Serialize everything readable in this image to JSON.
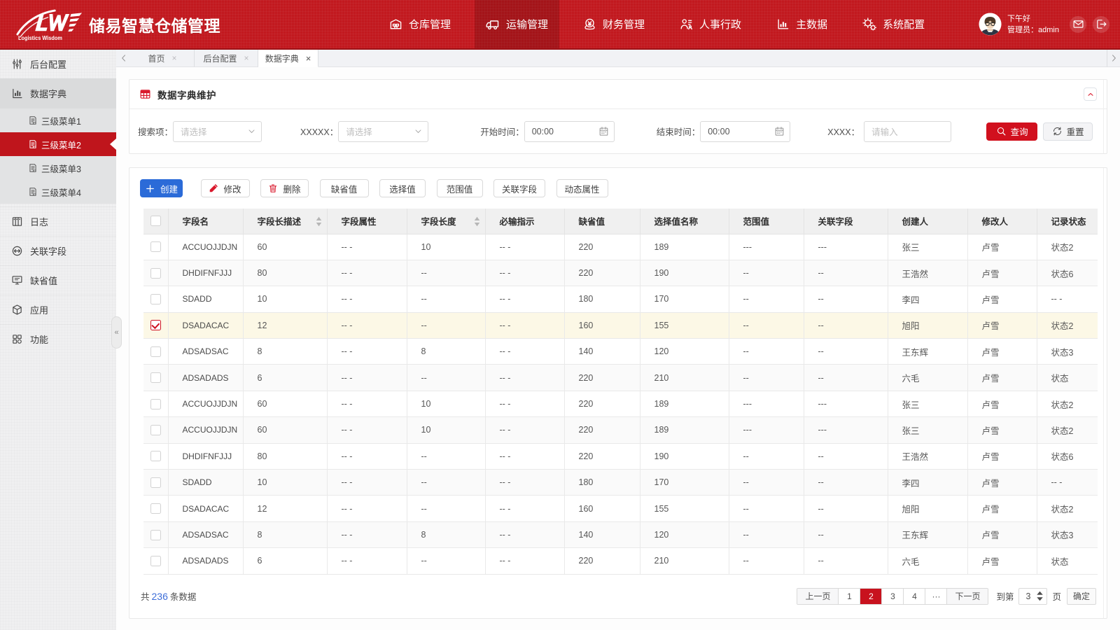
{
  "app": {
    "logo_mark": "LW",
    "logo_sub": "Logistics Wisdom",
    "title": "储易智慧仓储管理"
  },
  "topnav": {
    "items": [
      {
        "label": "仓库管理",
        "icon": "warehouse-icon",
        "active": false
      },
      {
        "label": "运输管理",
        "icon": "truck-icon",
        "active": true
      },
      {
        "label": "财务管理",
        "icon": "finance-icon",
        "active": false
      },
      {
        "label": "人事行政",
        "icon": "hr-icon",
        "active": false
      },
      {
        "label": "主数据",
        "icon": "masterdata-icon",
        "active": false
      },
      {
        "label": "系统配置",
        "icon": "gear-icon",
        "active": false
      }
    ]
  },
  "user": {
    "greeting": "下午好",
    "role": "管理员：admin"
  },
  "tabbar": {
    "tabs": [
      {
        "label": "首页",
        "active": false
      },
      {
        "label": "后台配置",
        "active": false
      },
      {
        "label": "数据字典",
        "active": true
      }
    ],
    "close_glyph": "×"
  },
  "sidebar": {
    "collapse_glyph": "«",
    "items": [
      {
        "label": "后台配置"
      },
      {
        "label": "数据字典",
        "open": true
      },
      {
        "label": "日志"
      },
      {
        "label": "关联字段"
      },
      {
        "label": "缺省值"
      },
      {
        "label": "应用"
      },
      {
        "label": "功能"
      }
    ],
    "submenu": [
      {
        "label": "三级菜单1",
        "active": false
      },
      {
        "label": "三级菜单2",
        "active": true
      },
      {
        "label": "三级菜单3",
        "active": false
      },
      {
        "label": "三级菜单4",
        "active": false
      }
    ]
  },
  "panel": {
    "title": "数据字典维护"
  },
  "filters": {
    "search_label": "搜索项：",
    "search_placeholder": "请选择",
    "xxxxx_label": "XXXXX：",
    "xxxxx_placeholder": "请选择",
    "start_label": "开始时间：",
    "start_value": "00:00",
    "end_label": "结束时间：",
    "end_value": "00:00",
    "xxxx_label": "XXXX：",
    "xxxx_placeholder": "请输入",
    "query_label": "查询",
    "reset_label": "重置"
  },
  "toolbar": {
    "buttons": [
      {
        "label": "创建",
        "kind": "primary",
        "icon": "plus-icon"
      },
      {
        "label": "修改",
        "kind": "default",
        "icon": "pencil-icon"
      },
      {
        "label": "删除",
        "kind": "default",
        "icon": "trash-icon"
      },
      {
        "label": "缺省值",
        "kind": "default"
      },
      {
        "label": "选择值",
        "kind": "default"
      },
      {
        "label": "范围值",
        "kind": "default"
      },
      {
        "label": "关联字段",
        "kind": "default"
      },
      {
        "label": "动态属性",
        "kind": "default"
      }
    ]
  },
  "table": {
    "columns": [
      {
        "label": "字段名",
        "sortable": false
      },
      {
        "label": "字段长描述",
        "sortable": true
      },
      {
        "label": "字段属性",
        "sortable": false
      },
      {
        "label": "字段长度",
        "sortable": true
      },
      {
        "label": "必输指示",
        "sortable": false
      },
      {
        "label": "缺省值",
        "sortable": false
      },
      {
        "label": "选择值名称",
        "sortable": false
      },
      {
        "label": "范围值",
        "sortable": false
      },
      {
        "label": "关联字段",
        "sortable": false
      },
      {
        "label": "创建人",
        "sortable": false
      },
      {
        "label": "修改人",
        "sortable": false
      },
      {
        "label": "记录状态",
        "sortable": false
      }
    ],
    "rows": [
      {
        "selected": false,
        "cells": [
          "ACCUOJJDJN",
          "60",
          "-- -",
          "10",
          "-- -",
          "220",
          "189",
          "---",
          "---",
          "张三",
          "卢雪",
          "状态2"
        ]
      },
      {
        "selected": false,
        "cells": [
          "DHDIFNFJJJ",
          "80",
          "-- -",
          "--",
          "-- -",
          "220",
          "190",
          "--",
          "--",
          "王浩然",
          "卢雪",
          "状态6"
        ]
      },
      {
        "selected": false,
        "cells": [
          "SDADD",
          "10",
          "-- -",
          "--",
          "-- -",
          "180",
          "170",
          "--",
          "--",
          "李四",
          "卢雪",
          "-- -"
        ]
      },
      {
        "selected": true,
        "cells": [
          "DSADACAC",
          "12",
          "-- -",
          "--",
          "-- -",
          "160",
          "155",
          "--",
          "--",
          "旭阳",
          "卢雪",
          "状态2"
        ]
      },
      {
        "selected": false,
        "cells": [
          "ADSADSAC",
          "8",
          "-- -",
          "8",
          "-- -",
          "140",
          "120",
          "--",
          "--",
          "王东辉",
          "卢雪",
          "状态3"
        ]
      },
      {
        "selected": false,
        "cells": [
          "ADSADADS",
          "6",
          "-- -",
          "--",
          "-- -",
          "220",
          "210",
          "--",
          "--",
          "六毛",
          "卢雪",
          "状态"
        ]
      },
      {
        "selected": false,
        "cells": [
          "ACCUOJJDJN",
          "60",
          "-- -",
          "10",
          "-- -",
          "220",
          "189",
          "---",
          "---",
          "张三",
          "卢雪",
          "状态2"
        ]
      },
      {
        "selected": false,
        "cells": [
          "ACCUOJJDJN",
          "60",
          "-- -",
          "10",
          "-- -",
          "220",
          "189",
          "---",
          "---",
          "张三",
          "卢雪",
          "状态2"
        ]
      },
      {
        "selected": false,
        "cells": [
          "DHDIFNFJJJ",
          "80",
          "-- -",
          "--",
          "-- -",
          "220",
          "190",
          "--",
          "--",
          "王浩然",
          "卢雪",
          "状态6"
        ]
      },
      {
        "selected": false,
        "cells": [
          "SDADD",
          "10",
          "-- -",
          "--",
          "-- -",
          "180",
          "170",
          "--",
          "--",
          "李四",
          "卢雪",
          "-- -"
        ]
      },
      {
        "selected": false,
        "cells": [
          "DSADACAC",
          "12",
          "-- -",
          "--",
          "-- -",
          "160",
          "155",
          "--",
          "--",
          "旭阳",
          "卢雪",
          "状态2"
        ]
      },
      {
        "selected": false,
        "cells": [
          "ADSADSAC",
          "8",
          "-- -",
          "8",
          "-- -",
          "140",
          "120",
          "--",
          "--",
          "王东辉",
          "卢雪",
          "状态3"
        ]
      },
      {
        "selected": false,
        "cells": [
          "ADSADADS",
          "6",
          "-- -",
          "--",
          "-- -",
          "220",
          "210",
          "--",
          "--",
          "六毛",
          "卢雪",
          "状态"
        ]
      }
    ]
  },
  "footer": {
    "total_prefix": "共",
    "total_count": "236",
    "total_suffix": "条数据",
    "prev": "上一页",
    "pages": [
      {
        "label": "1",
        "active": false
      },
      {
        "label": "2",
        "active": true
      },
      {
        "label": "3",
        "active": false
      },
      {
        "label": "4",
        "active": false
      },
      {
        "label": "···",
        "active": false
      }
    ],
    "next": "下一页",
    "goto_prefix": "到第",
    "goto_value": "3",
    "goto_suffix": "页",
    "confirm": "确定"
  },
  "colors": {
    "header_red": "#c2191f",
    "active_nav_red": "#a8131a",
    "sidebar_active_red": "#bf151c",
    "primary_blue": "#2b6bd8",
    "query_red": "#d1101e",
    "page_active_red": "#c8121e",
    "selected_row_yellow": "#fcf8e6",
    "link_blue": "#3d6dd8",
    "icon_red": "#d9182c"
  }
}
